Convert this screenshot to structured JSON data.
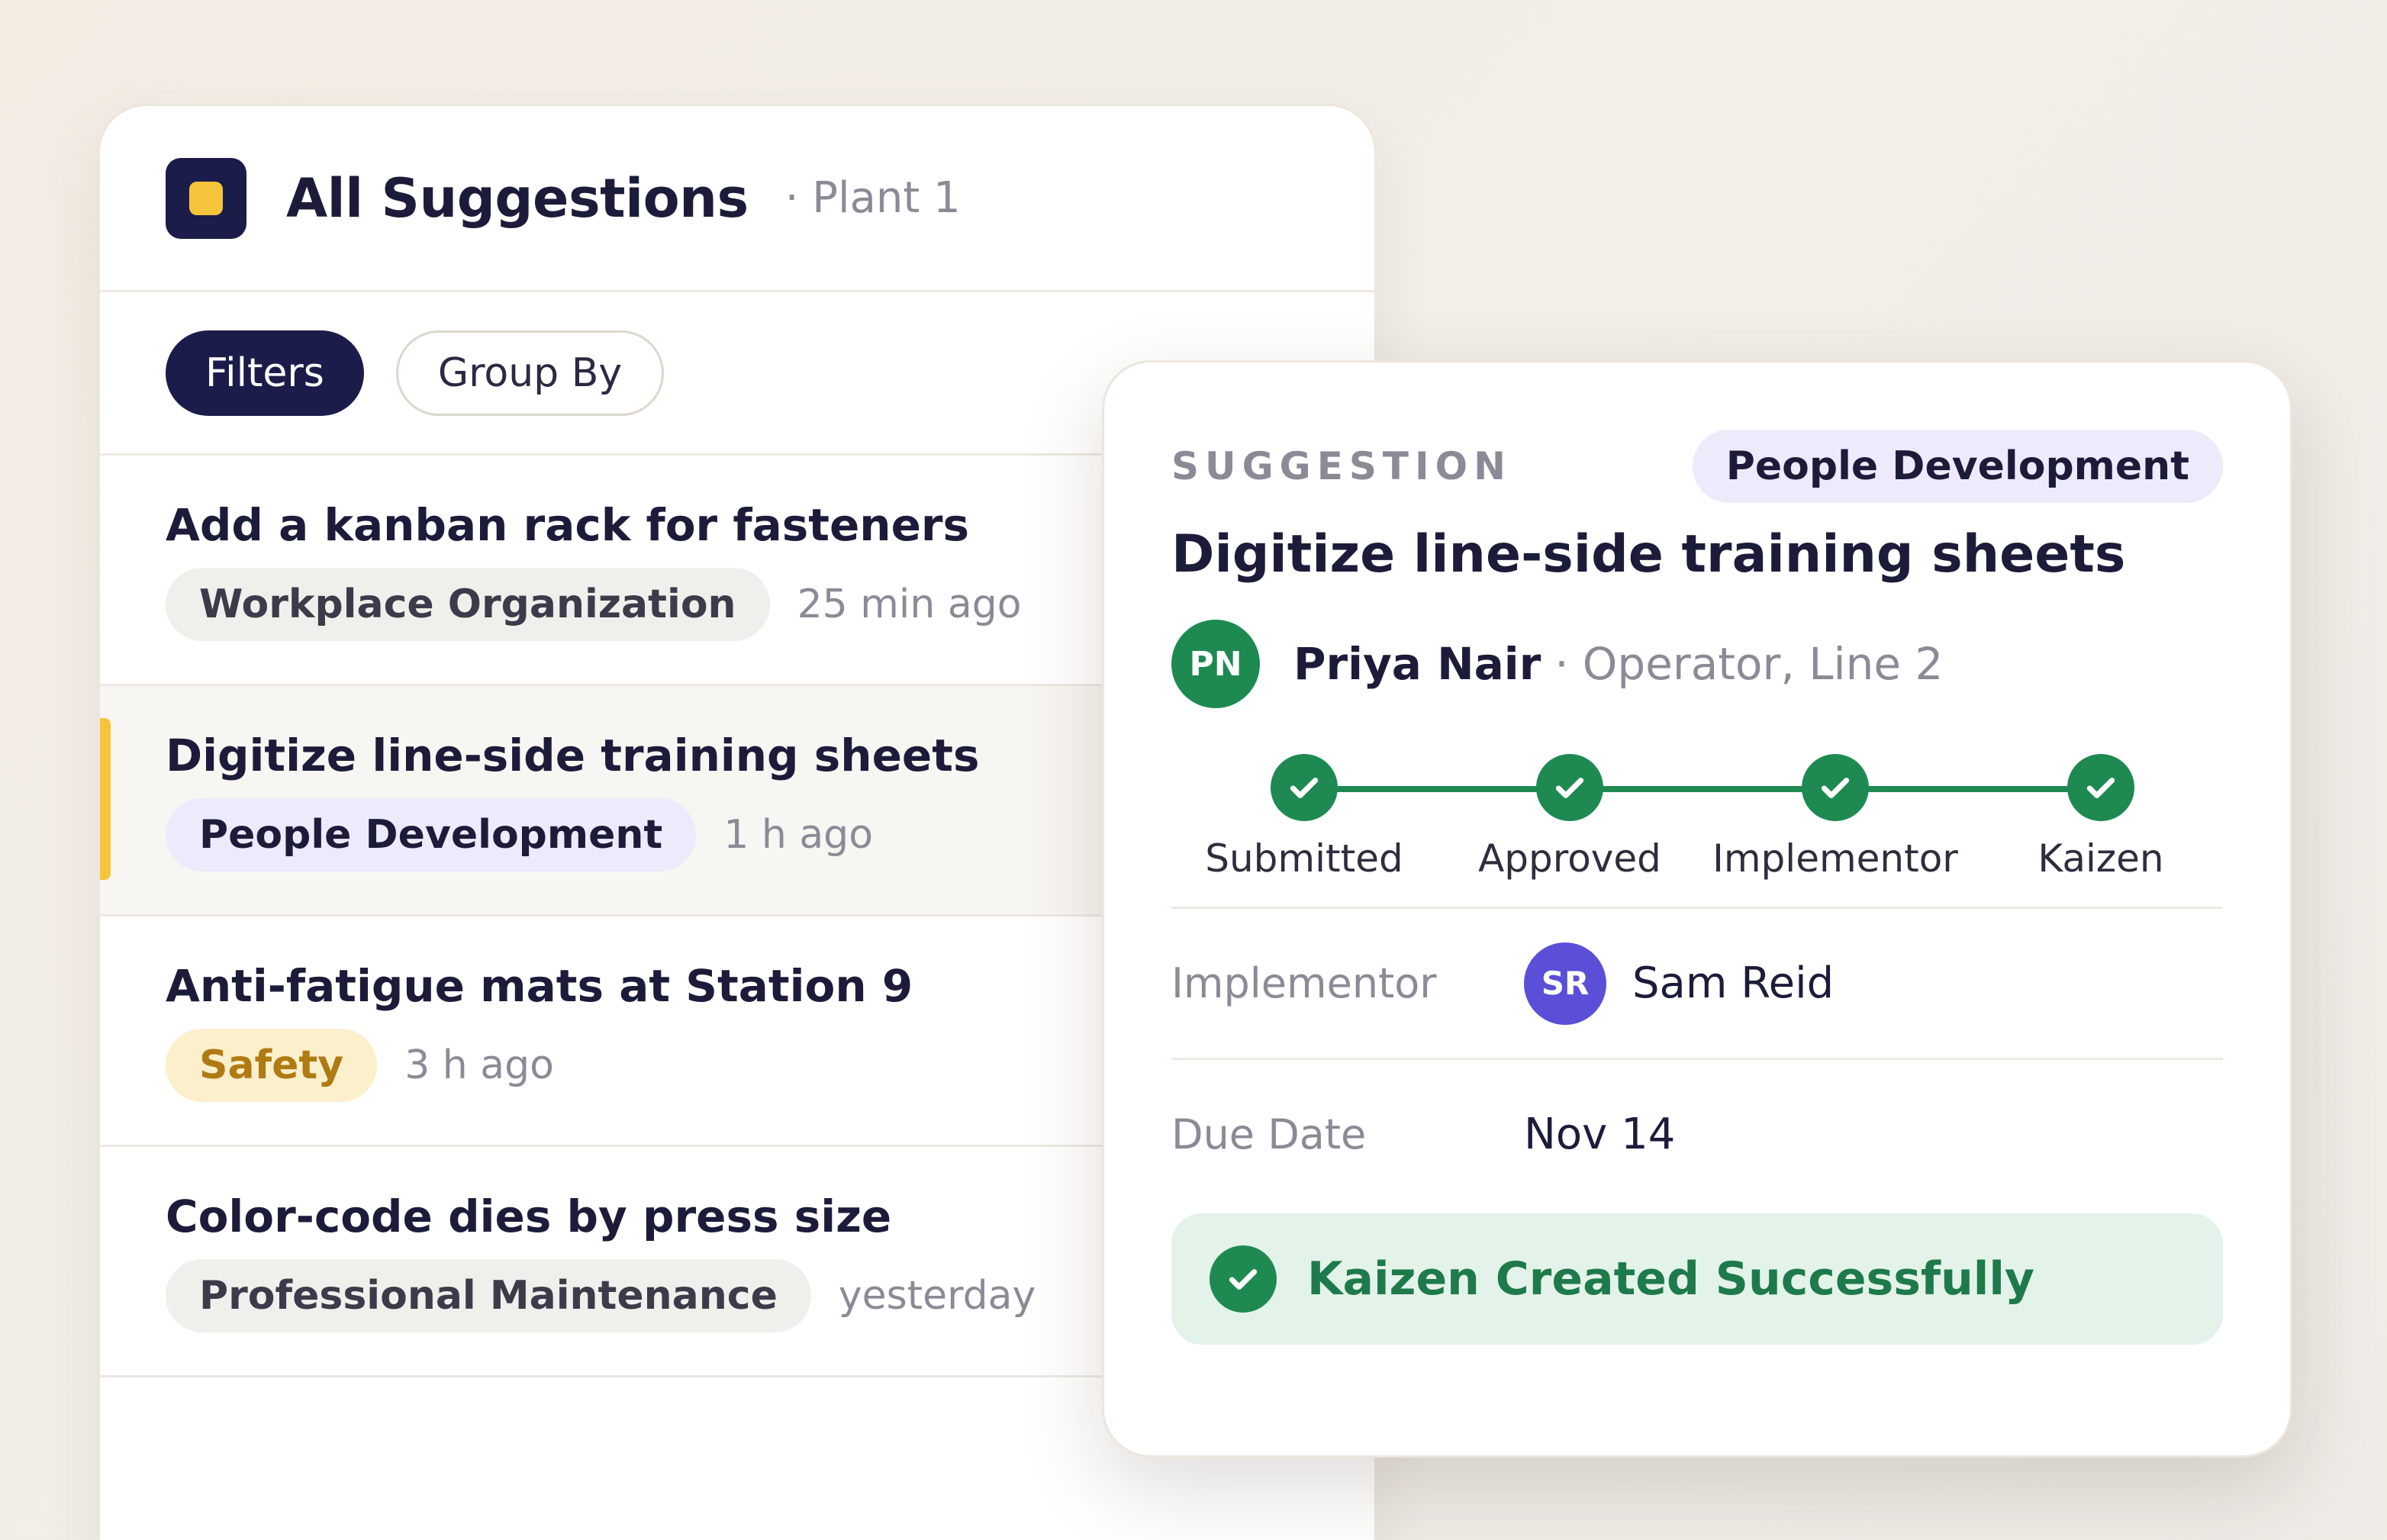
{
  "header": {
    "title": "All Suggestions",
    "subtitle": "· Plant 1"
  },
  "toolbar": {
    "filters_label": "Filters",
    "group_by_label": "Group By"
  },
  "suggestions": [
    {
      "title": "Add a kanban rack for fasteners",
      "category": "Workplace Organization",
      "time": "25 min ago"
    },
    {
      "title": "Digitize line-side training sheets",
      "category": "People Development",
      "time": "1 h ago"
    },
    {
      "title": "Anti-fatigue mats at Station 9",
      "category": "Safety",
      "time": "3 h ago"
    },
    {
      "title": "Color-code dies by press size",
      "category": "Professional Maintenance",
      "time": "yesterday"
    }
  ],
  "detail": {
    "eyebrow": "SUGGESTION",
    "category": "People Development",
    "title": "Digitize line-side training sheets",
    "author": {
      "initials": "PN",
      "name": "Priya Nair",
      "separator": "·",
      "role": "Operator, Line 2"
    },
    "steps": [
      {
        "label": "Submitted",
        "complete": true
      },
      {
        "label": "Approved",
        "complete": true
      },
      {
        "label": "Implementor",
        "complete": true
      },
      {
        "label": "Kaizen",
        "complete": true
      }
    ],
    "implementor": {
      "label": "Implementor",
      "initials": "SR",
      "name": "Sam Reid"
    },
    "due_date": {
      "label": "Due Date",
      "value": "Nov 14"
    },
    "success_message": "Kaizen Created Successfully"
  },
  "colors": {
    "navy": "#1c1c4a",
    "accent_yellow": "#f5c43a",
    "success_green": "#1e8a52",
    "implementor_avatar": "#5b4fd8",
    "tag_lavender": "#ecebfb",
    "tag_amber": "#fcefcc"
  },
  "icons": {
    "app_logo": "app-logo-icon",
    "step_check": "check-icon",
    "success": "check-circle-icon"
  }
}
